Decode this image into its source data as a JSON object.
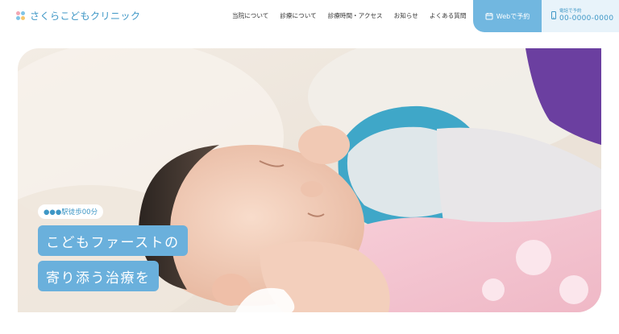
{
  "header": {
    "logo_text": "さくらこどもクリニック",
    "nav": [
      {
        "label": "当院について",
        "name": "nav-about"
      },
      {
        "label": "診療について",
        "name": "nav-treatment"
      },
      {
        "label": "診療時間・アクセス",
        "name": "nav-hours-access"
      },
      {
        "label": "お知らせ",
        "name": "nav-news"
      },
      {
        "label": "よくある質問",
        "name": "nav-faq"
      }
    ],
    "web_button": {
      "label": "Webで予約",
      "icon": "calendar-icon"
    },
    "tel": {
      "label": "電話で予約",
      "number": "00-0000-0000",
      "icon": "phone-icon"
    }
  },
  "hero": {
    "access_badge": "●●●駅徒歩00分",
    "catch_line1": "こどもファーストの",
    "catch_line2": "寄り添う治療を"
  },
  "colors": {
    "brand_blue": "#3e97c6",
    "button_blue": "#71b7e0",
    "catch_bg": "#6ab0dc",
    "tel_bg": "#e8f3fa"
  }
}
